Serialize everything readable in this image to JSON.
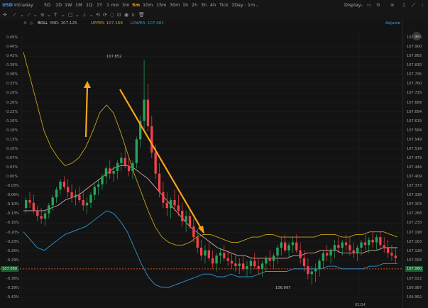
{
  "topbar": {
    "symbol": "USD",
    "timeframes": [
      "Intraday",
      "5D",
      "1D",
      "1W",
      "1M",
      "1Q",
      "1Y",
      "1 min",
      "3m",
      "5m",
      "10m",
      "15m",
      "30m",
      "1h",
      "2h",
      "3h",
      "4h",
      "Tick"
    ],
    "active": "5m",
    "interval": "1Day : 1m",
    "display": "Display"
  },
  "toolbar": {
    "adjusted": "Adjuste"
  },
  "indicator": {
    "name": "BOLL",
    "mid": "MID: 107.125",
    "upper": "UPPER: 107.168",
    "lower": "LOWER: 107.081"
  },
  "colors": {
    "up": "#26a65b",
    "down": "#f0424b",
    "mid": "#d9a6a0",
    "upper": "#c7a215",
    "lower": "#2f97d8",
    "arrow": "#ffa31a",
    "accent": "#ff9a1f"
  },
  "chart_data": {
    "type": "candlestick",
    "right_axis": [
      "107.935",
      "107.900",
      "107.865",
      "107.830",
      "107.795",
      "107.760",
      "107.725",
      "107.689",
      "107.654",
      "107.619",
      "107.584",
      "107.549",
      "107.514",
      "107.479",
      "107.444",
      "107.409",
      "107.373",
      "107.338",
      "107.303",
      "107.268",
      "107.233",
      "107.198",
      "107.163",
      "107.128",
      "107.093",
      "107.058",
      "107.022",
      "106.987",
      "106.952"
    ],
    "left_axis": [
      "0.49%",
      "0.46%",
      "0.42%",
      "0.39%",
      "0.36%",
      "0.33%",
      "0.29%",
      "0.26%",
      "0.23%",
      "0.20%",
      "0.16%",
      "0.13%",
      "0.10%",
      "0.07%",
      "0.03%",
      "0.00%",
      "-0.03%",
      "-0.06%",
      "-0.10%",
      "-0.13%",
      "-0.16%",
      "-0.20%",
      "-0.23%",
      "-0.26%",
      "-0.29%",
      "-0.32%",
      "-0.36%",
      "-0.39%",
      "-0.42%"
    ],
    "ylim": [
      106.952,
      107.935
    ],
    "ref_price": "107.060",
    "last_price": "107.093",
    "high_label": "107.852",
    "low_label": "106.997",
    "x_label": "02/14",
    "candles": [
      [
        107.29,
        107.33,
        107.27,
        107.32
      ],
      [
        107.32,
        107.35,
        107.29,
        107.31
      ],
      [
        107.31,
        107.34,
        107.27,
        107.28
      ],
      [
        107.28,
        107.3,
        107.24,
        107.26
      ],
      [
        107.26,
        107.29,
        107.23,
        107.25
      ],
      [
        107.25,
        107.28,
        107.22,
        107.27
      ],
      [
        107.27,
        107.31,
        107.25,
        107.3
      ],
      [
        107.3,
        107.34,
        107.28,
        107.33
      ],
      [
        107.33,
        107.37,
        107.31,
        107.36
      ],
      [
        107.36,
        107.4,
        107.34,
        107.39
      ],
      [
        107.39,
        107.41,
        107.36,
        107.37
      ],
      [
        107.37,
        107.4,
        107.33,
        107.35
      ],
      [
        107.35,
        107.38,
        107.31,
        107.33
      ],
      [
        107.33,
        107.36,
        107.3,
        107.34
      ],
      [
        107.34,
        107.37,
        107.31,
        107.32
      ],
      [
        107.32,
        107.35,
        107.28,
        107.3
      ],
      [
        107.3,
        107.33,
        107.27,
        107.31
      ],
      [
        107.31,
        107.35,
        107.29,
        107.34
      ],
      [
        107.34,
        107.38,
        107.32,
        107.37
      ],
      [
        107.37,
        107.4,
        107.34,
        107.38
      ],
      [
        107.38,
        107.42,
        107.36,
        107.41
      ],
      [
        107.41,
        107.45,
        107.38,
        107.44
      ],
      [
        107.44,
        107.47,
        107.4,
        107.42
      ],
      [
        107.42,
        107.45,
        107.39,
        107.43
      ],
      [
        107.43,
        107.47,
        107.4,
        107.46
      ],
      [
        107.46,
        107.5,
        107.43,
        107.48
      ],
      [
        107.48,
        107.52,
        107.44,
        107.45
      ],
      [
        107.45,
        107.48,
        107.41,
        107.43
      ],
      [
        107.43,
        107.47,
        107.4,
        107.46
      ],
      [
        107.46,
        107.56,
        107.44,
        107.55
      ],
      [
        107.55,
        107.64,
        107.52,
        107.62
      ],
      [
        107.62,
        107.85,
        107.58,
        107.7
      ],
      [
        107.7,
        107.76,
        107.58,
        107.6
      ],
      [
        107.6,
        107.64,
        107.48,
        107.5
      ],
      [
        107.5,
        107.53,
        107.4,
        107.42
      ],
      [
        107.42,
        107.46,
        107.33,
        107.35
      ],
      [
        107.35,
        107.39,
        107.29,
        107.31
      ],
      [
        107.31,
        107.35,
        107.26,
        107.29
      ],
      [
        107.29,
        107.33,
        107.25,
        107.32
      ],
      [
        107.32,
        107.36,
        107.28,
        107.3
      ],
      [
        107.3,
        107.34,
        107.26,
        107.28
      ],
      [
        107.28,
        107.31,
        107.22,
        107.24
      ],
      [
        107.24,
        107.28,
        107.2,
        107.26
      ],
      [
        107.26,
        107.29,
        107.21,
        107.22
      ],
      [
        107.22,
        107.25,
        107.16,
        107.18
      ],
      [
        107.18,
        107.21,
        107.12,
        107.14
      ],
      [
        107.14,
        107.17,
        107.09,
        107.11
      ],
      [
        107.11,
        107.15,
        107.08,
        107.13
      ],
      [
        107.13,
        107.16,
        107.09,
        107.1
      ],
      [
        107.1,
        107.13,
        107.06,
        107.08
      ],
      [
        107.08,
        107.12,
        107.05,
        107.11
      ],
      [
        107.11,
        107.14,
        107.08,
        107.12
      ],
      [
        107.12,
        107.15,
        107.09,
        107.1
      ],
      [
        107.1,
        107.13,
        107.07,
        107.09
      ],
      [
        107.09,
        107.12,
        107.06,
        107.08
      ],
      [
        107.08,
        107.11,
        107.05,
        107.07
      ],
      [
        107.07,
        107.1,
        107.04,
        107.08
      ],
      [
        107.08,
        107.11,
        107.05,
        107.06
      ],
      [
        107.06,
        107.09,
        107.03,
        107.07
      ],
      [
        107.07,
        107.1,
        107.04,
        107.09
      ],
      [
        107.09,
        107.12,
        107.06,
        107.07
      ],
      [
        107.07,
        107.1,
        107.04,
        107.06
      ],
      [
        107.06,
        107.09,
        107.03,
        107.08
      ],
      [
        107.08,
        107.11,
        107.05,
        107.1
      ],
      [
        107.1,
        107.13,
        107.07,
        107.09
      ],
      [
        107.09,
        107.12,
        107.06,
        107.11
      ],
      [
        107.11,
        107.15,
        107.08,
        107.14
      ],
      [
        107.14,
        107.18,
        107.11,
        107.16
      ],
      [
        107.16,
        107.19,
        107.12,
        107.13
      ],
      [
        107.13,
        107.16,
        107.1,
        107.15
      ],
      [
        107.15,
        107.18,
        107.12,
        107.16
      ],
      [
        107.16,
        107.19,
        107.12,
        107.13
      ],
      [
        107.13,
        107.16,
        107.08,
        107.1
      ],
      [
        107.1,
        107.13,
        107.05,
        107.07
      ],
      [
        107.07,
        107.1,
        107.02,
        107.04
      ],
      [
        107.04,
        107.07,
        107.0,
        107.05
      ],
      [
        107.05,
        107.08,
        107.01,
        107.06
      ],
      [
        107.06,
        107.1,
        107.03,
        107.09
      ],
      [
        107.09,
        107.13,
        107.06,
        107.12
      ],
      [
        107.12,
        107.15,
        107.09,
        107.11
      ],
      [
        107.11,
        107.14,
        107.08,
        107.13
      ],
      [
        107.13,
        107.17,
        107.1,
        107.15
      ],
      [
        107.15,
        107.18,
        107.12,
        107.14
      ],
      [
        107.14,
        107.17,
        107.11,
        107.16
      ],
      [
        107.16,
        107.19,
        107.13,
        107.15
      ],
      [
        107.15,
        107.18,
        107.11,
        107.13
      ],
      [
        107.13,
        107.16,
        107.1,
        107.12
      ],
      [
        107.12,
        107.15,
        107.09,
        107.14
      ],
      [
        107.14,
        107.17,
        107.11,
        107.16
      ],
      [
        107.16,
        107.19,
        107.13,
        107.15
      ],
      [
        107.15,
        107.18,
        107.12,
        107.17
      ],
      [
        107.17,
        107.2,
        107.14,
        107.16
      ],
      [
        107.16,
        107.19,
        107.13,
        107.18
      ],
      [
        107.18,
        107.2,
        107.14,
        107.15
      ],
      [
        107.15,
        107.18,
        107.12,
        107.14
      ],
      [
        107.14,
        107.17,
        107.1,
        107.12
      ],
      [
        107.12,
        107.15,
        107.09,
        107.11
      ],
      [
        107.11,
        107.14,
        107.08,
        107.1
      ]
    ],
    "mid": [
      107.28,
      107.28,
      107.28,
      107.28,
      107.29,
      107.3,
      107.32,
      107.33,
      107.34,
      107.36,
      107.38,
      107.4,
      107.42,
      107.44,
      107.45,
      107.45,
      107.44,
      107.42,
      107.4,
      107.37,
      107.34,
      107.31,
      107.28,
      107.25,
      107.22,
      107.2,
      107.18,
      107.16,
      107.14,
      107.13,
      107.12,
      107.11,
      107.11,
      107.1,
      107.1,
      107.1,
      107.1,
      107.1,
      107.1,
      107.11,
      107.11,
      107.12,
      107.12,
      107.13,
      107.13,
      107.13,
      107.12,
      107.12,
      107.12,
      107.12,
      107.13,
      107.13,
      107.14,
      107.14,
      107.14
    ],
    "upper": [
      107.88,
      107.78,
      107.68,
      107.58,
      107.52,
      107.48,
      107.45,
      107.46,
      107.48,
      107.52,
      107.58,
      107.65,
      107.68,
      107.65,
      107.58,
      107.5,
      107.42,
      107.35,
      107.28,
      107.22,
      107.18,
      107.16,
      107.15,
      107.15,
      107.16,
      107.18,
      107.19,
      107.19,
      107.18,
      107.17,
      107.16,
      107.16,
      107.17,
      107.18,
      107.18,
      107.19,
      107.19,
      107.18,
      107.18,
      107.18,
      107.18,
      107.18,
      107.18,
      107.19,
      107.19,
      107.19,
      107.18,
      107.18,
      107.19,
      107.19,
      107.2,
      107.2,
      107.2,
      107.19,
      107.18
    ],
    "lower": [
      107.2,
      107.17,
      107.14,
      107.13,
      107.15,
      107.17,
      107.19,
      107.2,
      107.21,
      107.22,
      107.24,
      107.26,
      107.28,
      107.27,
      107.24,
      107.2,
      107.14,
      107.08,
      107.03,
      107.0,
      106.99,
      106.99,
      107.0,
      107.01,
      107.02,
      107.03,
      107.04,
      107.04,
      107.03,
      107.03,
      107.04,
      107.03,
      107.03,
      107.03,
      107.04,
      107.05,
      107.05,
      107.05,
      107.05,
      107.06,
      107.06,
      107.06,
      107.06,
      107.06,
      107.07,
      107.07,
      107.06,
      107.06,
      107.06,
      107.06,
      107.07,
      107.07,
      107.08,
      107.08,
      107.08
    ]
  }
}
